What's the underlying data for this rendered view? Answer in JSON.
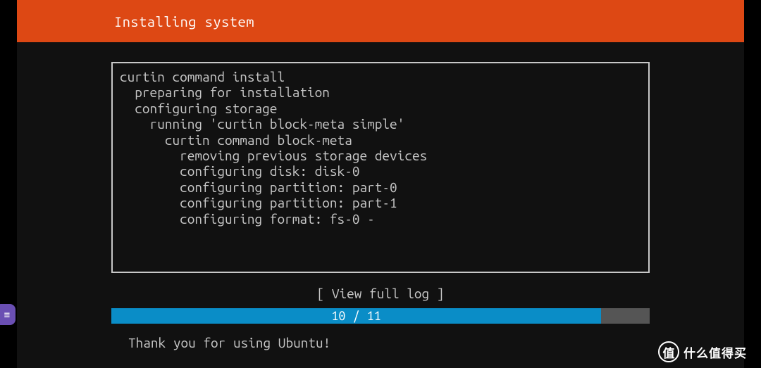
{
  "header": {
    "title": "Installing system"
  },
  "log": {
    "lines": [
      {
        "indent": 0,
        "text": "curtin command install"
      },
      {
        "indent": 1,
        "text": "preparing for installation"
      },
      {
        "indent": 1,
        "text": "configuring storage"
      },
      {
        "indent": 2,
        "text": "running 'curtin block-meta simple'"
      },
      {
        "indent": 3,
        "text": "curtin command block-meta"
      },
      {
        "indent": 4,
        "text": "removing previous storage devices"
      },
      {
        "indent": 4,
        "text": "configuring disk: disk-0"
      },
      {
        "indent": 4,
        "text": "configuring partition: part-0"
      },
      {
        "indent": 4,
        "text": "configuring partition: part-1"
      },
      {
        "indent": 4,
        "text": "configuring format: fs-0 -"
      }
    ]
  },
  "actions": {
    "view_log_label": "[ View full log ]"
  },
  "progress": {
    "current": 10,
    "total": 11,
    "label": "10 / 11",
    "percent_width": "91%"
  },
  "footer": {
    "thanks": "Thank you for using Ubuntu!"
  },
  "side_tab": {
    "icon": "≡"
  },
  "watermark": {
    "badge": "值",
    "text": "什么值得买"
  },
  "colors": {
    "accent": "#dd4814",
    "progress": "#0a8dc7",
    "text": "#c8c8c8"
  }
}
